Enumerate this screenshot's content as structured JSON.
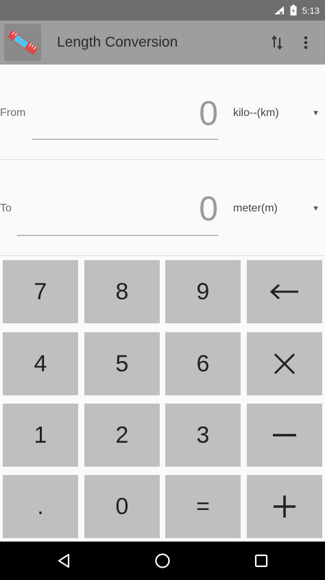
{
  "status_bar": {
    "time": "5:13"
  },
  "app_bar": {
    "title": "Length Conversion",
    "logo_icon": "ruler-app-icon",
    "actions": [
      {
        "name": "swap-units-icon"
      },
      {
        "name": "more-vert-icon"
      }
    ]
  },
  "from": {
    "label": "From",
    "value": "0",
    "unit": "kilo--(km)"
  },
  "to": {
    "label": "To",
    "value": "0",
    "unit": "meter(m)"
  },
  "keypad": {
    "keys": [
      "7",
      "8",
      "9",
      "←",
      "4",
      "5",
      "6",
      "×",
      "1",
      "2",
      "3",
      "−",
      ".",
      "0",
      "=",
      "+"
    ]
  },
  "nav_bar": {
    "buttons": [
      "back-icon",
      "home-icon",
      "recents-icon"
    ]
  },
  "colors": {
    "status_bar": "#6e6e6e",
    "app_bar": "#9e9e9e",
    "key": "#bfbfbf",
    "background": "#fafafa",
    "nav_bar": "#000000"
  }
}
